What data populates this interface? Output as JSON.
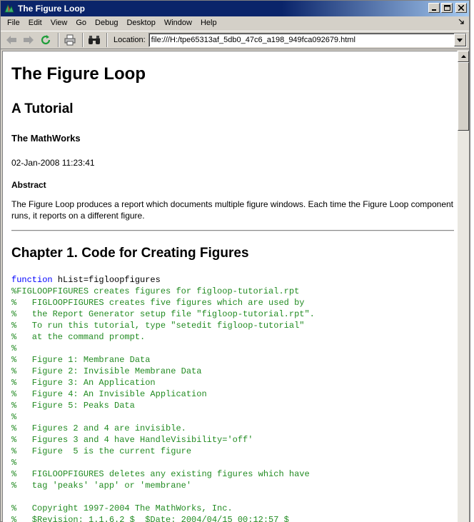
{
  "window": {
    "title": "The Figure Loop"
  },
  "menu": {
    "items": [
      "File",
      "Edit",
      "View",
      "Go",
      "Debug",
      "Desktop",
      "Window",
      "Help"
    ]
  },
  "toolbar": {
    "location_label": "Location:",
    "location_value": "file:///H:/tpe65313af_5db0_47c6_a198_949fca092679.html"
  },
  "document": {
    "title": "The Figure Loop",
    "subtitle": "A Tutorial",
    "author": "The MathWorks",
    "date": "02-Jan-2008 11:23:41",
    "abstract_heading": "Abstract",
    "abstract_text": "The Figure Loop produces a report which documents multiple figure windows. Each time the Figure Loop component runs, it reports on a different figure.",
    "chapter_title": "Chapter 1. Code for Creating Figures",
    "code_keyword": "function",
    "code_signature": " hList=figloopfigures",
    "code_comments": [
      "%FIGLOOPFIGURES creates figures for figloop-tutorial.rpt",
      "%   FIGLOOPFIGURES creates five figures which are used by",
      "%   the Report Generator setup file \"figloop-tutorial.rpt\".",
      "%   To run this tutorial, type \"setedit figloop-tutorial\"",
      "%   at the command prompt.",
      "%",
      "%   Figure 1: Membrane Data",
      "%   Figure 2: Invisible Membrane Data",
      "%   Figure 3: An Application",
      "%   Figure 4: An Invisible Application",
      "%   Figure 5: Peaks Data",
      "%",
      "%   Figures 2 and 4 are invisible.",
      "%   Figures 3 and 4 have HandleVisibility='off'",
      "%   Figure  5 is the current figure",
      "%",
      "%   FIGLOOPFIGURES deletes any existing figures which have",
      "%   tag 'peaks' 'app' or 'membrane'",
      "",
      "%   Copyright 1997-2004 The MathWorks, Inc.",
      "%   $Revision: 1.1.6.2 $  $Date: 2004/04/15 00:12:57 $"
    ]
  },
  "colors": {
    "titlebar": "#0a246a",
    "keyword": "#0000ff",
    "comment": "#228b22"
  }
}
